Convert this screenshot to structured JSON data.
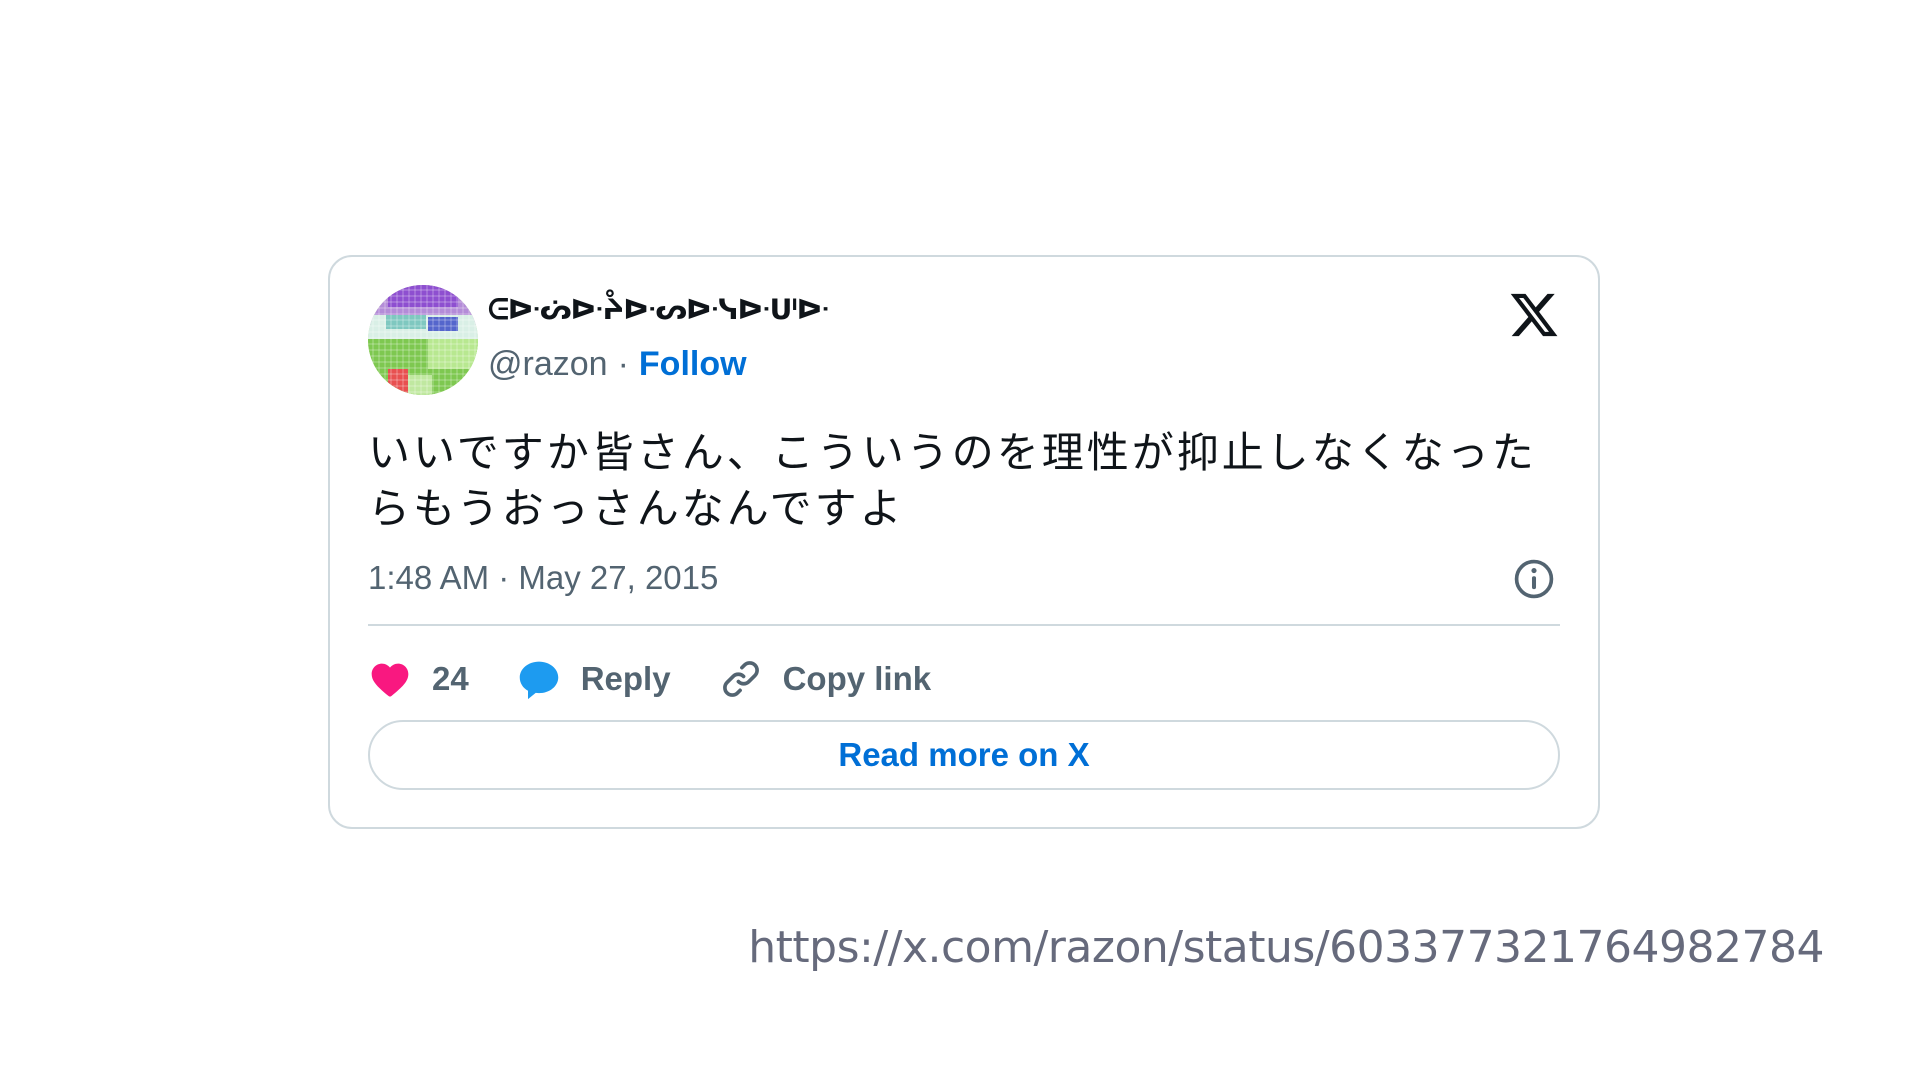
{
  "tweet": {
    "display_name": "ᕮᐅᐧᔖᐅᐧᔧᐅᐧᔕᐅᐧᓭᐅᐧᑧᐅᐧ",
    "handle": "@razon",
    "separator": "·",
    "follow_label": "Follow",
    "text": "いいですか皆さん、こういうのを理性が抑止しなくなったらもうおっさんなんですよ",
    "timestamp": "1:48 AM · May 27, 2015",
    "likes_count": "24",
    "reply_label": "Reply",
    "copy_link_label": "Copy link",
    "read_more_label": "Read more on X",
    "icons": {
      "logo": "x-logo-icon",
      "info": "info-icon",
      "like": "heart-icon",
      "reply": "speech-bubble-icon",
      "copy": "link-icon"
    }
  },
  "caption": {
    "url": "https://x.com/razon/status/603377321764982784"
  },
  "colors": {
    "link_blue": "#006fd6",
    "heart_pink": "#f91880",
    "reply_blue": "#1d9bf0",
    "muted_text": "#536471",
    "border": "#cfd9de"
  }
}
